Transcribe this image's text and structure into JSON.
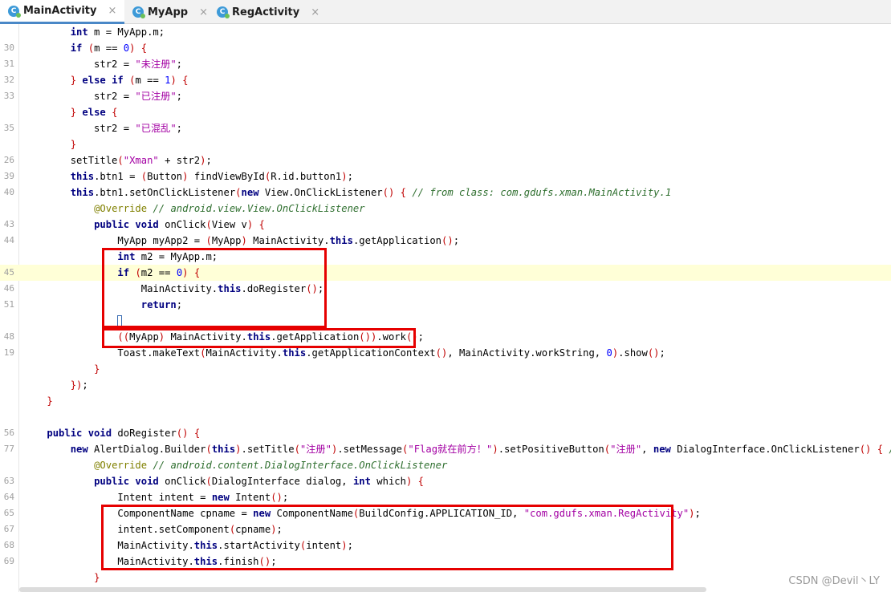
{
  "tabs": [
    {
      "label": "MainActivity",
      "icon": "java-class-icon",
      "active": true
    },
    {
      "label": "MyApp",
      "icon": "java-class-icon",
      "active": false
    },
    {
      "label": "RegActivity",
      "icon": "java-class-icon",
      "active": false
    }
  ],
  "close_glyph": "×",
  "watermark": "CSDN @Devil丶LY",
  "lines": [
    {
      "n": "",
      "html": "        <span class=\"kw\">int</span> m = MyApp.m;"
    },
    {
      "n": "30",
      "html": "        <span class=\"kw\">if</span> <span class=\"br\">(</span>m == <span class=\"num\">0</span><span class=\"br\">)</span> <span class=\"br\">{</span>"
    },
    {
      "n": "31",
      "html": "            str2 = <span class=\"strp\">\"未注册\"</span>;"
    },
    {
      "n": "32",
      "html": "        <span class=\"br\">}</span> <span class=\"kw\">else if</span> <span class=\"br\">(</span>m == <span class=\"num\">1</span><span class=\"br\">)</span> <span class=\"br\">{</span>"
    },
    {
      "n": "33",
      "html": "            str2 = <span class=\"strp\">\"已注册\"</span>;"
    },
    {
      "n": "",
      "html": "        <span class=\"br\">}</span> <span class=\"kw\">else</span> <span class=\"br\">{</span>"
    },
    {
      "n": "35",
      "html": "            str2 = <span class=\"strp\">\"已混乱\"</span>;"
    },
    {
      "n": "",
      "html": "        <span class=\"br\">}</span>"
    },
    {
      "n": "26",
      "html": "        setTitle<span class=\"br\">(</span><span class=\"strp\">\"Xman\"</span> + str2<span class=\"br\">)</span>;"
    },
    {
      "n": "39",
      "html": "        <span class=\"kw\">this</span>.btn1 = <span class=\"br\">(</span>Button<span class=\"br\">)</span> findViewById<span class=\"br\">(</span>R.id.button1<span class=\"br\">)</span>;"
    },
    {
      "n": "40",
      "html": "        <span class=\"kw\">this</span>.btn1.setOnClickListener<span class=\"br\">(</span><span class=\"kw\">new</span> View.OnClickListener<span class=\"br\">()</span> <span class=\"br\">{</span> <span class=\"cm\">// from class: com.gdufs.xman.MainActivity.1</span>"
    },
    {
      "n": "",
      "html": "            <span class=\"an\">@Override</span> <span class=\"cm\">// android.view.View.OnClickListener</span>"
    },
    {
      "n": "43",
      "html": "            <span class=\"kw\">public void</span> onClick<span class=\"br\">(</span>View v<span class=\"br\">)</span> <span class=\"br\">{</span>"
    },
    {
      "n": "44",
      "html": "                MyApp myApp2 = <span class=\"br\">(</span>MyApp<span class=\"br\">)</span> MainActivity.<span class=\"kw\">this</span>.getApplication<span class=\"br\">()</span>;"
    },
    {
      "n": "",
      "html": "                <span class=\"kw\">int</span> m2 = MyApp.m;"
    },
    {
      "n": "45",
      "html": "                <span class=\"kw\">if</span> <span class=\"br\">(</span>m2 == <span class=\"num\">0</span><span class=\"br\">)</span> <span class=\"br\">{</span>",
      "hl": true
    },
    {
      "n": "46",
      "html": "                    MainActivity.<span class=\"kw\">this</span>.doRegister<span class=\"br\">()</span>;"
    },
    {
      "n": "51",
      "html": "                    <span class=\"kw\">return</span>;"
    },
    {
      "n": "",
      "html": "                <span class=\"caret-box\"></span>"
    },
    {
      "n": "48",
      "html": "                <span class=\"br\">((</span>MyApp<span class=\"br\">)</span> MainActivity.<span class=\"kw\">this</span>.getApplication<span class=\"br\">())</span>.work<span class=\"br\">()</span>;"
    },
    {
      "n": "19",
      "html": "                Toast.makeText<span class=\"br\">(</span>MainActivity.<span class=\"kw\">this</span>.getApplicationContext<span class=\"br\">()</span>, MainActivity.workString, <span class=\"num\">0</span><span class=\"br\">)</span>.show<span class=\"br\">()</span>;"
    },
    {
      "n": "",
      "html": "            <span class=\"br\">}</span>"
    },
    {
      "n": "",
      "html": "        <span class=\"br\">})</span>;"
    },
    {
      "n": "",
      "html": "    <span class=\"br\">}</span>"
    },
    {
      "n": "",
      "html": ""
    },
    {
      "n": "56",
      "html": "    <span class=\"kw\">public void</span> doRegister<span class=\"br\">()</span> <span class=\"br\">{</span>"
    },
    {
      "n": "77",
      "html": "        <span class=\"kw\">new</span> AlertDialog.Builder<span class=\"br\">(</span><span class=\"kw\">this</span><span class=\"br\">)</span>.setTitle<span class=\"br\">(</span><span class=\"strp\">\"注册\"</span><span class=\"br\">)</span>.setMessage<span class=\"br\">(</span><span class=\"strp\">\"Flag就在前方！\"</span><span class=\"br\">)</span>.setPositiveButton<span class=\"br\">(</span><span class=\"strp\">\"注册\"</span>, <span class=\"kw\">new</span> DialogInterface.OnClickListener<span class=\"br\">()</span> <span class=\"br\">{</span> <span class=\"cm\">// fr</span>"
    },
    {
      "n": "",
      "html": "            <span class=\"an\">@Override</span> <span class=\"cm\">// android.content.DialogInterface.OnClickListener</span>"
    },
    {
      "n": "63",
      "html": "            <span class=\"kw\">public void</span> onClick<span class=\"br\">(</span>DialogInterface dialog, <span class=\"kw\">int</span> which<span class=\"br\">)</span> <span class=\"br\">{</span>"
    },
    {
      "n": "64",
      "html": "                Intent intent = <span class=\"kw\">new</span> Intent<span class=\"br\">()</span>;"
    },
    {
      "n": "65",
      "html": "                ComponentName cpname = <span class=\"kw\">new</span> ComponentName<span class=\"br\">(</span>BuildConfig.APPLICATION_ID, <span class=\"strp\">\"com.gdufs.xman.RegActivity\"</span><span class=\"br\">)</span>;"
    },
    {
      "n": "67",
      "html": "                intent.setComponent<span class=\"br\">(</span>cpname<span class=\"br\">)</span>;"
    },
    {
      "n": "68",
      "html": "                MainActivity.<span class=\"kw\">this</span>.startActivity<span class=\"br\">(</span>intent<span class=\"br\">)</span>;"
    },
    {
      "n": "69",
      "html": "                MainActivity.<span class=\"kw\">this</span>.finish<span class=\"br\">()</span>;"
    },
    {
      "n": "",
      "html": "            <span class=\"br\">}</span>"
    }
  ]
}
